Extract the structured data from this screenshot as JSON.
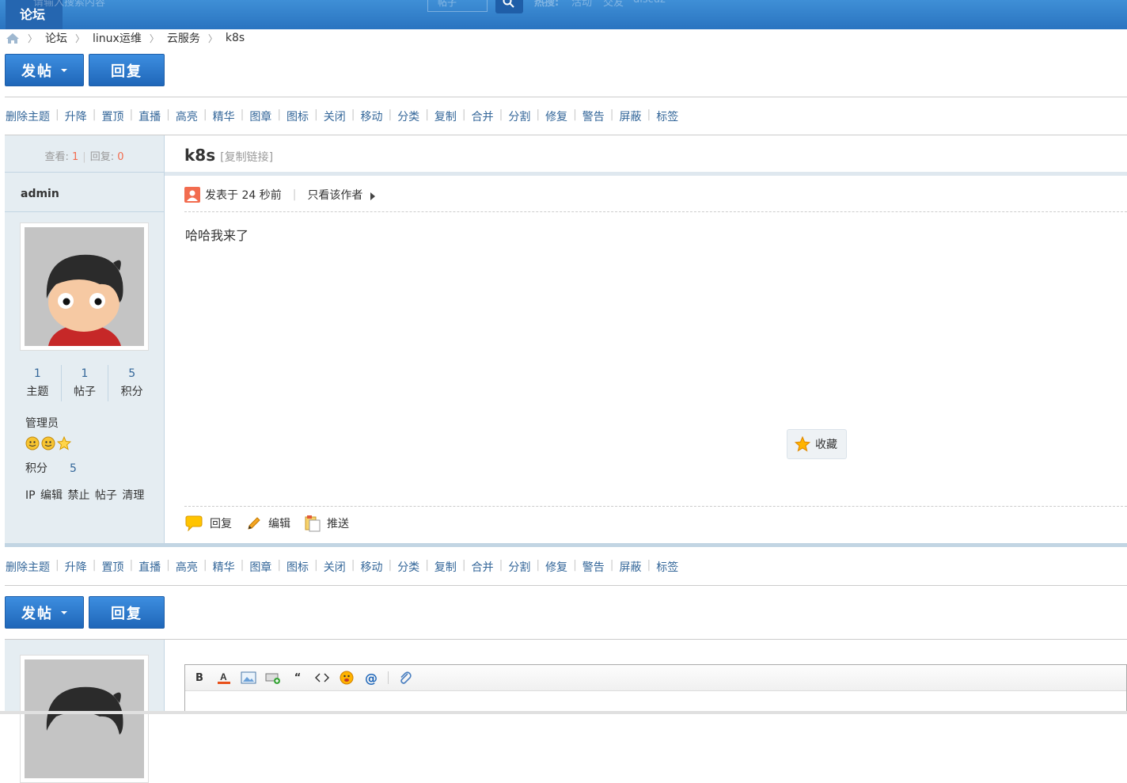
{
  "header": {
    "logo": "论坛",
    "search_placeholder": "请输入搜索内容",
    "search_type": "帖子",
    "hot_label": "热搜:",
    "hot_terms": [
      "活动",
      "交友",
      "discuz"
    ]
  },
  "breadcrumb": [
    "论坛",
    "linux运维",
    "云服务",
    "k8s"
  ],
  "buttons": {
    "post": "发帖",
    "reply": "回复"
  },
  "mod_links": [
    "删除主题",
    "升降",
    "置顶",
    "直播",
    "高亮",
    "精华",
    "图章",
    "图标",
    "关闭",
    "移动",
    "分类",
    "复制",
    "合并",
    "分割",
    "修复",
    "警告",
    "屏蔽",
    "标签"
  ],
  "thread": {
    "views_label": "查看:",
    "views": "1",
    "replies_label": "回复:",
    "replies": "0",
    "title": "k8s",
    "copy_link": "[复制链接]"
  },
  "author": {
    "name": "admin",
    "stats": [
      {
        "value": "1",
        "label": "主题"
      },
      {
        "value": "1",
        "label": "帖子"
      },
      {
        "value": "5",
        "label": "积分"
      }
    ],
    "group": "管理员",
    "points_label": "积分",
    "points": "5",
    "ops": "IP 编辑 禁止 帖子 清理"
  },
  "post": {
    "posted": "发表于 24 秒前",
    "only_author": "只看该作者",
    "content": "哈哈我来了",
    "favorite": "收藏",
    "actions": {
      "reply": "回复",
      "edit": "编辑",
      "push": "推送"
    }
  },
  "editor": {
    "tools": [
      "bold-icon",
      "font-color-icon",
      "image-icon",
      "add-image-icon",
      "quote-icon",
      "code-icon",
      "smiley-icon",
      "mention-icon",
      "attachment-icon"
    ]
  }
}
